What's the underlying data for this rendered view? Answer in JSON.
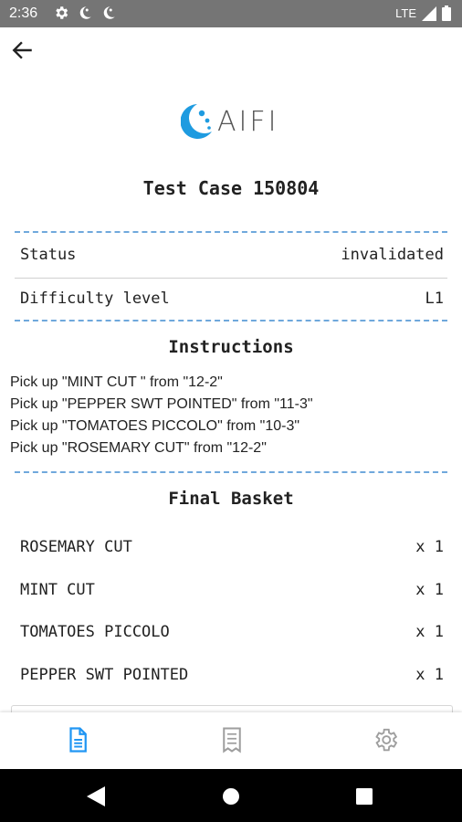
{
  "status_bar": {
    "time": "2:36",
    "network": "LTE",
    "left_icons": [
      "gear-icon",
      "app-notification-icon",
      "app-notification-icon"
    ],
    "right_icons": [
      "signal-icon",
      "battery-icon"
    ]
  },
  "header": {
    "back_icon": "arrow-left-icon"
  },
  "logo": {
    "text": "AIFI",
    "accent_color": "#1e9be0"
  },
  "test_case": {
    "title": "Test Case 150804"
  },
  "details": [
    {
      "label": "Status",
      "value": "invalidated"
    },
    {
      "label": "Difficulty level",
      "value": "L1"
    }
  ],
  "instructions": {
    "title": "Instructions",
    "items": [
      "Pick up \"MINT CUT \" from \"12-2\"",
      "Pick up \"PEPPER SWT POINTED\" from \"11-3\"",
      "Pick up \"TOMATOES PICCOLO\" from \"10-3\"",
      "Pick up \"ROSEMARY CUT\" from \"12-2\""
    ]
  },
  "final_basket": {
    "title": "Final Basket",
    "items": [
      {
        "name": "ROSEMARY CUT",
        "qty": "x 1"
      },
      {
        "name": "MINT CUT",
        "qty": "x 1"
      },
      {
        "name": "TOMATOES PICCOLO",
        "qty": "x 1"
      },
      {
        "name": "PEPPER SWT POINTED",
        "qty": "x 1"
      }
    ]
  },
  "bottom_nav": {
    "items": [
      {
        "icon": "document-icon",
        "active": true
      },
      {
        "icon": "receipt-icon",
        "active": false
      },
      {
        "icon": "settings-gear-icon",
        "active": false
      }
    ],
    "active_color": "#2196f3",
    "inactive_color": "#9e9e9e"
  },
  "system_nav": {
    "icons": [
      "back-triangle-icon",
      "home-circle-icon",
      "recents-square-icon"
    ]
  }
}
